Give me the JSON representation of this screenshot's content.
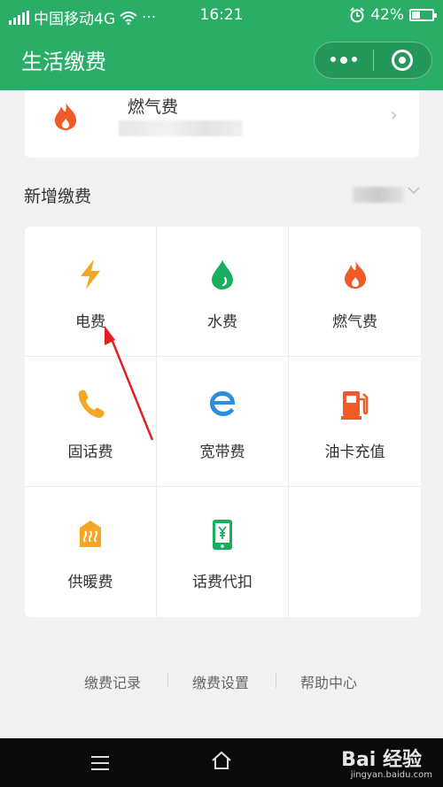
{
  "status_bar": {
    "carrier": "中国移动4G",
    "more": "···",
    "time": "16:21",
    "battery": "42%"
  },
  "header": {
    "title": "生活缴费",
    "more_icon": "more-dots-icon",
    "close_icon": "target-close-icon"
  },
  "gas_card": {
    "name": "燃气费",
    "icon": "flame-icon"
  },
  "section": {
    "title": "新增缴费"
  },
  "grid": {
    "items": [
      {
        "label": "电费",
        "icon": "lightning-icon"
      },
      {
        "label": "水费",
        "icon": "water-drop-icon"
      },
      {
        "label": "燃气费",
        "icon": "flame-icon"
      },
      {
        "label": "固话费",
        "icon": "phone-icon"
      },
      {
        "label": "宽带费",
        "icon": "broadband-e-icon"
      },
      {
        "label": "油卡充值",
        "icon": "fuel-pump-icon"
      },
      {
        "label": "供暖费",
        "icon": "heating-icon"
      },
      {
        "label": "话费代扣",
        "icon": "mobile-yuan-icon"
      }
    ]
  },
  "footer": {
    "records": "缴费记录",
    "settings": "缴费设置",
    "help": "帮助中心"
  },
  "watermark": {
    "brand": "Bai 经验",
    "url": "jingyan.baidu.com"
  },
  "colors": {
    "brand_green": "#2aae67",
    "electric_orange": "#f5a623",
    "water_green": "#1aad5e",
    "gas_red": "#f05a28",
    "broadband_blue": "#2a8ee0",
    "arrow_red": "#e02020"
  }
}
